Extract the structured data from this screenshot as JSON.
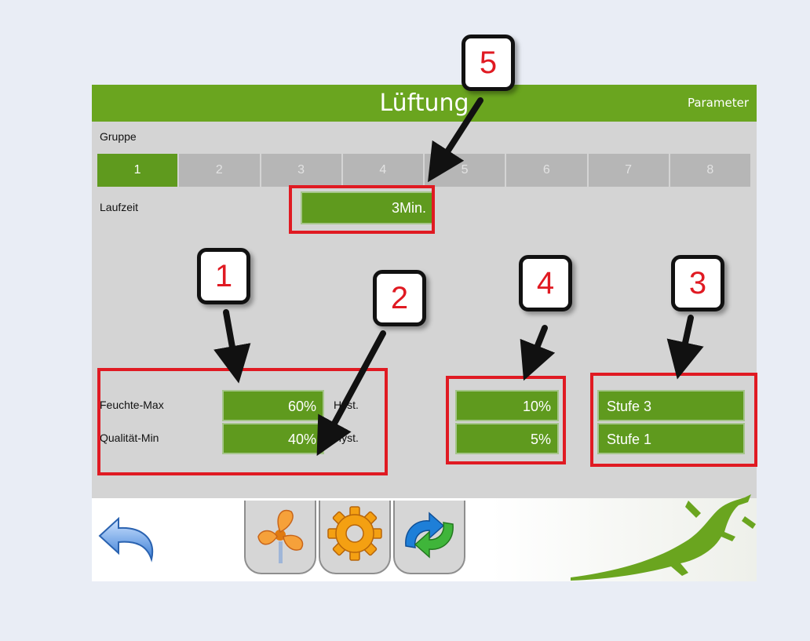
{
  "header": {
    "title": "Lüftung",
    "parameter_link": "Parameter"
  },
  "group": {
    "label": "Gruppe",
    "tabs": [
      "1",
      "2",
      "3",
      "4",
      "5",
      "6",
      "7",
      "8"
    ],
    "active_index": 0
  },
  "runtime": {
    "label": "Laufzeit",
    "value": "3Min."
  },
  "thresholds": {
    "humidity": {
      "label": "Feuchte-Max",
      "value": "60%",
      "hyst_label": "Hyst.",
      "hyst_value": "10%",
      "stage": "Stufe 3"
    },
    "quality": {
      "label": "Qualität-Min",
      "value": "40%",
      "hyst_label": "Hyst.",
      "hyst_value": "5%",
      "stage": "Stufe 1"
    }
  },
  "dock": {
    "back_icon": "back-arrow-icon",
    "items": [
      "fan-icon",
      "gear-icon",
      "sync-arrows-icon"
    ],
    "logo": "gecko-logo"
  },
  "annotations": [
    "1",
    "2",
    "3",
    "4",
    "5"
  ],
  "colors": {
    "header_green": "#6aa51f",
    "field_green": "#5f9a1e",
    "annotation_red": "#e01a22",
    "panel_gray": "#d4d4d4"
  }
}
